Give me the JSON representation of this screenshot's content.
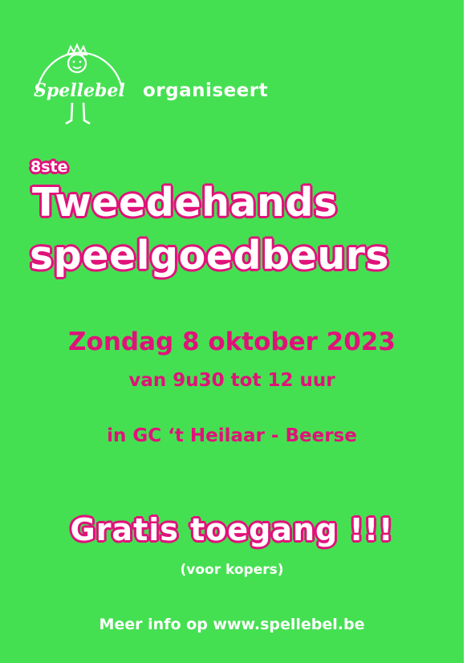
{
  "logo": {
    "wordmark": "Spellebel",
    "icon": "spellebel-logo-icon"
  },
  "organiser_text": "organiseert",
  "edition": "8ste",
  "title_line1": "Tweedehands",
  "title_line2": "speelgoedbeurs",
  "date": "Zondag 8 oktober 2023",
  "time": "van 9u30 tot 12 uur",
  "location": "in GC ‘t Heilaar - Beerse",
  "free_entry": "Gratis toegang !!!",
  "free_entry_note": "(voor kopers)",
  "more_info": "Meer info op www.spellebel.be",
  "colors": {
    "background": "#45e052",
    "accent": "#e0127a",
    "text": "#ffffff"
  }
}
